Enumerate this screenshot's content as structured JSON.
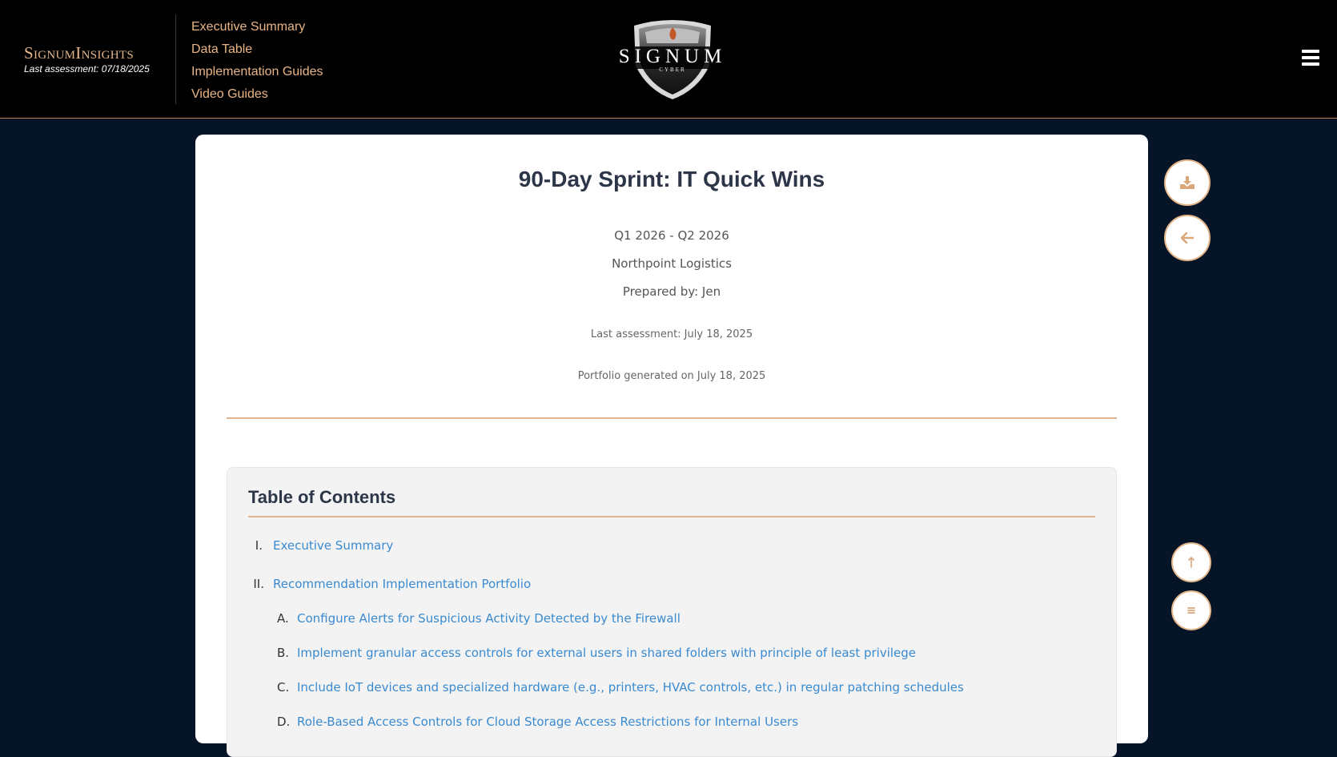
{
  "header": {
    "brand": "SignumInsights",
    "last_assessment": "Last assessment: 07/18/2025",
    "nav": [
      "Executive Summary",
      "Data Table",
      "Implementation Guides",
      "Video Guides"
    ],
    "logo_text": "SIGNUM",
    "logo_sub": "CYBER",
    "menu_icon": "hamburger-icon"
  },
  "document": {
    "title": "90-Day Sprint: IT Quick Wins",
    "period": "Q1 2026 - Q2 2026",
    "company": "Northpoint Logistics",
    "prepared_by": "Prepared by: Jen",
    "last_assessment": "Last assessment: July 18, 2025",
    "generated": "Portfolio generated on July 18, 2025"
  },
  "toc": {
    "title": "Table of Contents",
    "items": [
      {
        "num": "I.",
        "label": "Executive Summary"
      },
      {
        "num": "II.",
        "label": "Recommendation Implementation Portfolio"
      }
    ],
    "subitems": [
      {
        "num": "A.",
        "label": "Configure Alerts for Suspicious Activity Detected by the Firewall"
      },
      {
        "num": "B.",
        "label": "Implement granular access controls for external users in shared folders with principle of least privilege"
      },
      {
        "num": "C.",
        "label": "Include IoT devices and specialized hardware (e.g., printers, HVAC controls, etc.) in regular patching schedules"
      },
      {
        "num": "D.",
        "label": "Role-Based Access Controls for Cloud Storage Access Restrictions for Internal Users"
      }
    ]
  },
  "actions": {
    "download_icon": "download-icon",
    "back_icon": "arrow-left-icon",
    "top_icon": "arrow-up-icon",
    "toc_icon": "list-icon"
  },
  "colors": {
    "header_bg": "#000000",
    "page_bg": "#061428",
    "accent": "#e3b58a",
    "link": "#3a8ad0",
    "title": "#2d3648"
  }
}
